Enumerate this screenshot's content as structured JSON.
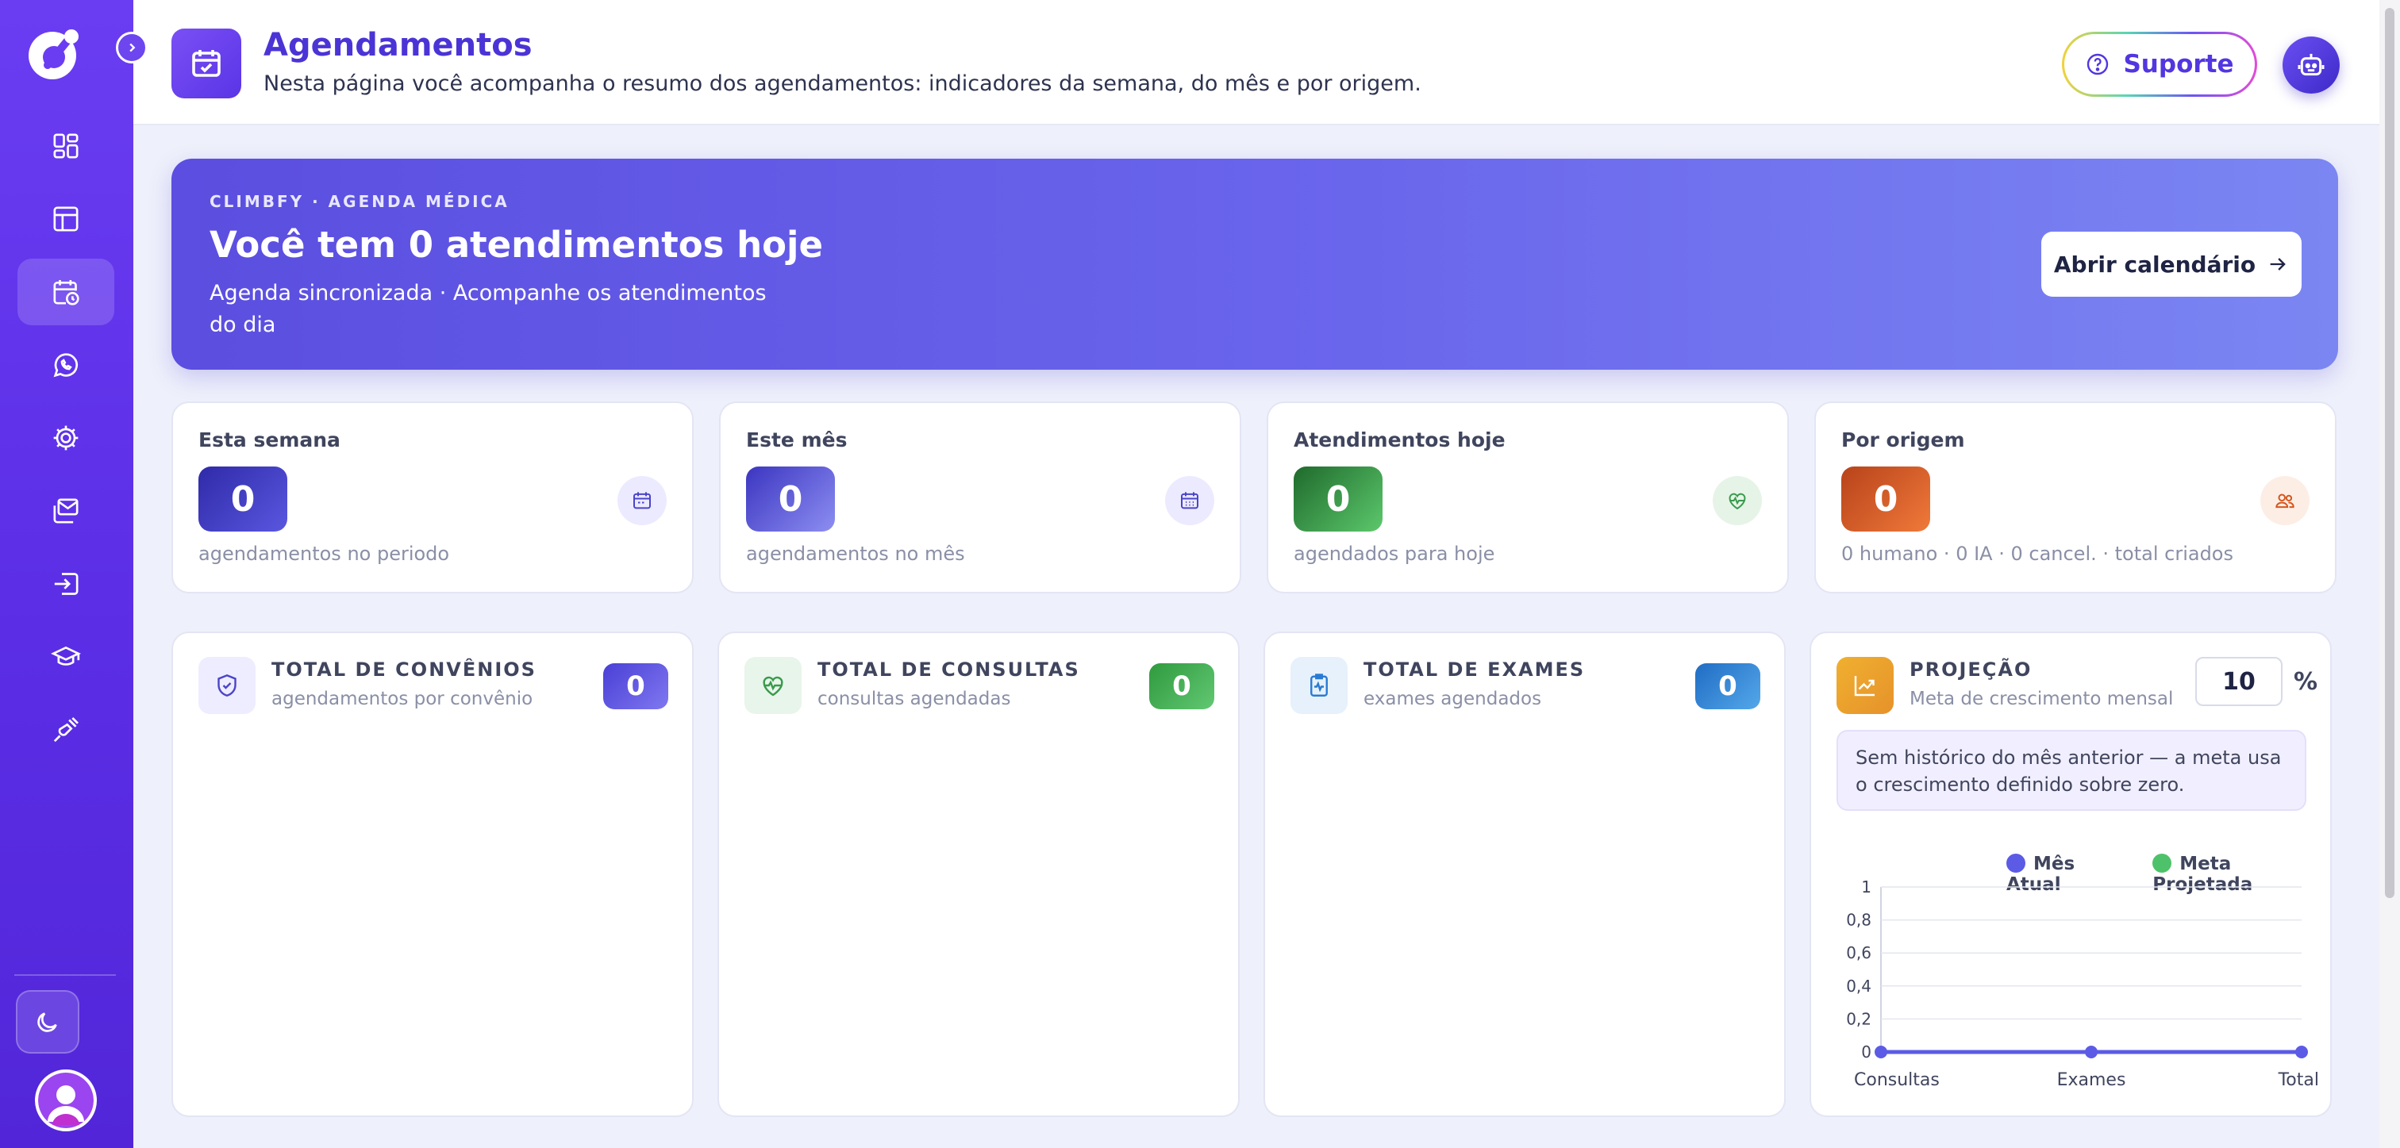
{
  "header": {
    "title": "Agendamentos",
    "subtitle": "Nesta página você acompanha o resumo dos agendamentos: indicadores da semana, do mês e por origem.",
    "support_label": "Suporte"
  },
  "sidebar": {
    "items": [
      {
        "icon": "dashboard-icon"
      },
      {
        "icon": "layout-icon"
      },
      {
        "icon": "calendar-clock-icon",
        "active": true
      },
      {
        "icon": "whatsapp-icon"
      },
      {
        "icon": "gear-icon"
      },
      {
        "icon": "mail-icon"
      },
      {
        "icon": "login-icon"
      },
      {
        "icon": "graduation-cap-icon"
      },
      {
        "icon": "plug-icon"
      }
    ]
  },
  "hero": {
    "kicker": "CLIMBFY · AGENDA MÉDICA",
    "title": "Você tem 0 atendimentos hoje",
    "text": "Agenda sincronizada · Acompanhe os atendimentos do dia",
    "button_label": "Abrir calendário"
  },
  "stats": [
    {
      "label": "Esta semana",
      "value": "0",
      "foot": "agendamentos no periodo",
      "icon": "calendar-icon"
    },
    {
      "label": "Este mês",
      "value": "0",
      "foot": "agendamentos no mês",
      "icon": "calendar-grid-icon"
    },
    {
      "label": "Atendimentos hoje",
      "value": "0",
      "foot": "agendados para hoje",
      "icon": "heart-pulse-icon"
    },
    {
      "label": "Por origem",
      "value": "0",
      "foot": "0 humano · 0 IA · 0 cancel. · total criados",
      "icon": "users-icon"
    }
  ],
  "cards": [
    {
      "title": "TOTAL DE CONVÊNIOS",
      "sub": "agendamentos por convênio",
      "value": "0",
      "icon": "shield-check-icon"
    },
    {
      "title": "TOTAL DE CONSULTAS",
      "sub": "consultas agendadas",
      "value": "0",
      "icon": "heart-pulse-icon"
    },
    {
      "title": "TOTAL DE EXAMES",
      "sub": "exames agendados",
      "value": "0",
      "icon": "clipboard-pulse-icon"
    }
  ],
  "projection": {
    "title": "PROJEÇÃO",
    "sub": "Meta de crescimento mensal",
    "meta_value": "10",
    "meta_unit": "%",
    "note": "Sem histórico do mês anterior — a meta usa o crescimento definido sobre zero."
  },
  "colors": {
    "accent": "#5b3ee6",
    "week": "#3f36c6",
    "month": "#4d46d4",
    "today": "#2f8a3e",
    "origin": "#d4571f",
    "consultas": "#3fae4e",
    "exames": "#2a7bd2",
    "convenios": "#5b4ee0",
    "mes_atual": "#5b5be6",
    "meta_projetada": "#4ec26a"
  },
  "chart_data": {
    "type": "line",
    "categories": [
      "Consultas",
      "Exames",
      "Total"
    ],
    "series": [
      {
        "name": "Mês Atual",
        "values": [
          0,
          0,
          0
        ]
      },
      {
        "name": "Meta Projetada",
        "values": [
          0,
          0,
          0
        ]
      }
    ],
    "yticks": [
      "0",
      "0,2",
      "0,4",
      "0,6",
      "0,8",
      "1"
    ],
    "ylim": [
      0,
      1
    ],
    "grid": true,
    "legend_position": "top-right"
  }
}
